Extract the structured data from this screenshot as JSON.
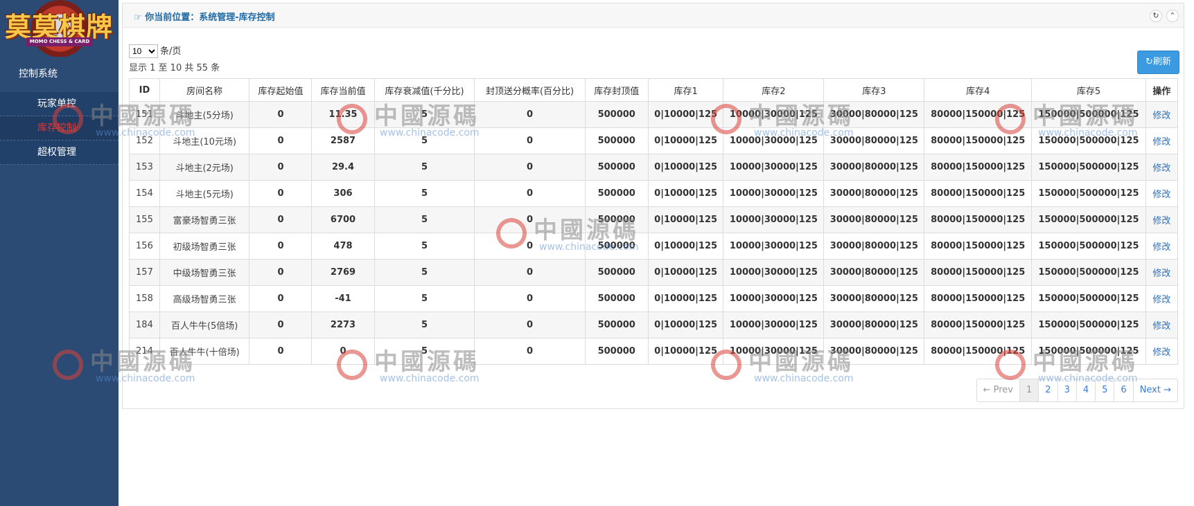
{
  "logo": {
    "title": "莫莫棋牌",
    "subtitle": "MOMO CHESS & CARD"
  },
  "sidebar": {
    "system_title": "控制系统",
    "items": [
      {
        "label": "玩家单控",
        "active": false
      },
      {
        "label": "库存控制",
        "active": true
      },
      {
        "label": "超权管理",
        "active": false
      }
    ]
  },
  "header": {
    "breadcrumb": "你当前位置：系统管理-库存控制",
    "icons": [
      "refresh-icon",
      "collapse-icon"
    ]
  },
  "toolbar": {
    "page_size": "10",
    "page_size_label": "条/页",
    "info": "显示 1 至 10 共 55 条",
    "refresh_label": "刷新"
  },
  "table": {
    "columns": [
      "ID",
      "房间名称",
      "库存起始值",
      "库存当前值",
      "库存衰减值(千分比)",
      "封顶送分概率(百分比)",
      "库存封顶值",
      "库存1",
      "库存2",
      "库存3",
      "库存4",
      "库存5",
      "操作"
    ],
    "rows": [
      [
        "151",
        "斗地主(5分场)",
        "0",
        "11.35",
        "5",
        "0",
        "500000",
        "0|10000|125",
        "10000|30000|125",
        "30000|80000|125",
        "80000|150000|125",
        "150000|500000|125",
        "修改"
      ],
      [
        "152",
        "斗地主(10元场)",
        "0",
        "2587",
        "5",
        "0",
        "500000",
        "0|10000|125",
        "10000|30000|125",
        "30000|80000|125",
        "80000|150000|125",
        "150000|500000|125",
        "修改"
      ],
      [
        "153",
        "斗地主(2元场)",
        "0",
        "29.4",
        "5",
        "0",
        "500000",
        "0|10000|125",
        "10000|30000|125",
        "30000|80000|125",
        "80000|150000|125",
        "150000|500000|125",
        "修改"
      ],
      [
        "154",
        "斗地主(5元场)",
        "0",
        "306",
        "5",
        "0",
        "500000",
        "0|10000|125",
        "10000|30000|125",
        "30000|80000|125",
        "80000|150000|125",
        "150000|500000|125",
        "修改"
      ],
      [
        "155",
        "富豪场智勇三张",
        "0",
        "6700",
        "5",
        "0",
        "500000",
        "0|10000|125",
        "10000|30000|125",
        "30000|80000|125",
        "80000|150000|125",
        "150000|500000|125",
        "修改"
      ],
      [
        "156",
        "初级场智勇三张",
        "0",
        "478",
        "5",
        "0",
        "500000",
        "0|10000|125",
        "10000|30000|125",
        "30000|80000|125",
        "80000|150000|125",
        "150000|500000|125",
        "修改"
      ],
      [
        "157",
        "中级场智勇三张",
        "0",
        "2769",
        "5",
        "0",
        "500000",
        "0|10000|125",
        "10000|30000|125",
        "30000|80000|125",
        "80000|150000|125",
        "150000|500000|125",
        "修改"
      ],
      [
        "158",
        "高级场智勇三张",
        "0",
        "-41",
        "5",
        "0",
        "500000",
        "0|10000|125",
        "10000|30000|125",
        "30000|80000|125",
        "80000|150000|125",
        "150000|500000|125",
        "修改"
      ],
      [
        "184",
        "百人牛牛(5倍场)",
        "0",
        "2273",
        "5",
        "0",
        "500000",
        "0|10000|125",
        "10000|30000|125",
        "30000|80000|125",
        "80000|150000|125",
        "150000|500000|125",
        "修改"
      ],
      [
        "214",
        "百人牛牛(十倍场)",
        "0",
        "0",
        "5",
        "0",
        "500000",
        "0|10000|125",
        "10000|30000|125",
        "30000|80000|125",
        "80000|150000|125",
        "150000|500000|125",
        "修改"
      ]
    ]
  },
  "pagination": {
    "prev": "← Prev",
    "pages": [
      "1",
      "2",
      "3",
      "4",
      "5",
      "6"
    ],
    "current": "1",
    "next": "Next →"
  },
  "watermark": {
    "text": "中國源碼",
    "url": "www.chinacode.com"
  }
}
